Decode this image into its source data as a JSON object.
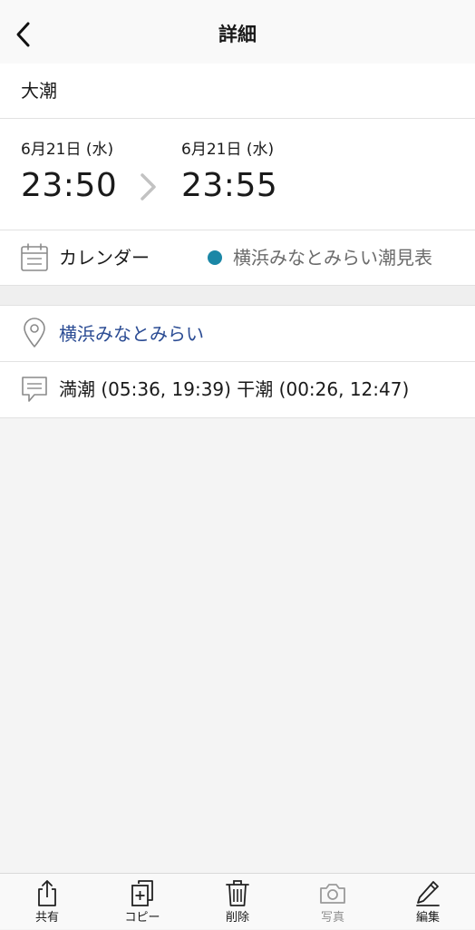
{
  "header": {
    "title": "詳細",
    "back_icon": "chevron-left-icon"
  },
  "event": {
    "title": "大潮",
    "start": {
      "date": "6月21日 (水)",
      "time": "23:50"
    },
    "end": {
      "date": "6月21日 (水)",
      "time": "23:55"
    }
  },
  "calendar": {
    "label": "カレンダー",
    "name": "横浜みなとみらい潮見表",
    "color": "#1b87a6",
    "icon": "calendar-icon"
  },
  "location": {
    "text": "横浜みなとみらい",
    "color": "#2a4b93",
    "icon": "location-pin-icon"
  },
  "note": {
    "text": "満潮 (05:36, 19:39) 干潮 (00:26, 12:47)",
    "icon": "comment-icon"
  },
  "tabbar": {
    "items": [
      {
        "label": "共有",
        "icon": "share-icon"
      },
      {
        "label": "コピー",
        "icon": "copy-icon"
      },
      {
        "label": "削除",
        "icon": "trash-icon"
      },
      {
        "label": "写真",
        "icon": "camera-icon",
        "disabled": true
      },
      {
        "label": "編集",
        "icon": "pencil-icon"
      }
    ]
  }
}
